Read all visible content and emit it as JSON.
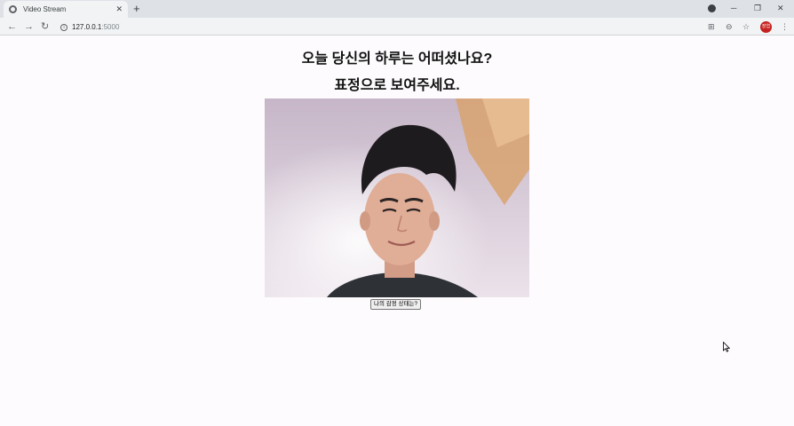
{
  "browser": {
    "tab_title": "Video Stream",
    "tab_close": "✕",
    "new_tab": "+",
    "url_host": "127.0.0.1",
    "url_port": ":5000",
    "profile_initials": "장엽",
    "minimize": "─",
    "restore": "❐",
    "close": "✕"
  },
  "page": {
    "heading_1": "오늘 당신의 하루는 어떠셨나요?",
    "heading_2": "표정으로 보여주세요.",
    "button_label": "나의 감정 상태는?"
  },
  "colors": {
    "profile": "#c5221f",
    "tabstrip": "#dee1e6",
    "toolbar": "#f1f3f4"
  }
}
